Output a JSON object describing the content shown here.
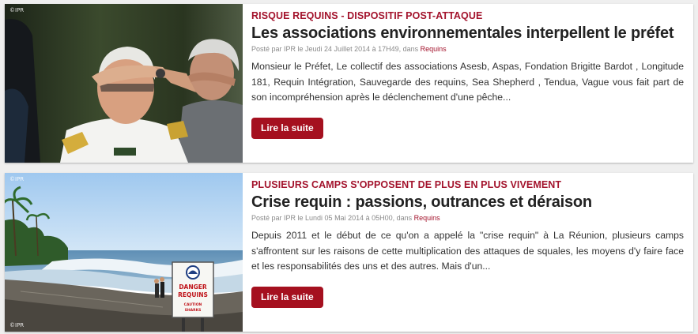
{
  "articles": [
    {
      "kicker": "RISQUE REQUINS - DISPOSITIF POST-ATTAQUE",
      "title": "Les associations environnementales interpellent le préfet",
      "meta_prefix": "Posté par IPR le Jeudi 24 Juillet 2014 à 17H49, dans",
      "category": "Requins",
      "excerpt": "Monsieur le Préfet, Le collectif des associations Asesb, Aspas, Fondation Brigitte Bardot , Longitude 181, Requin Intégration, Sauvegarde des requins, Sea Shepherd , Tendua, Vague vous fait part de son incompréhension après le déclenchement d'une pêche...",
      "button": "Lire la suite",
      "watermark": "©IPR"
    },
    {
      "kicker": "PLUSIEURS CAMPS S'OPPOSENT DE PLUS EN PLUS VIVEMENT",
      "title": "Crise requin : passions, outrances et déraison",
      "meta_prefix": "Posté par IPR le Lundi 05 Mai 2014 à 05H00, dans",
      "category": "Requins",
      "excerpt": "Depuis 2011 et le début de ce qu'on a appelé la \"crise requin\" à La Réunion, plusieurs camps s'affrontent sur les raisons de cette multiplication des attaques de squales, les moyens d'y faire face et les responsabilités des uns et des autres. Mais d'un...",
      "button": "Lire la suite",
      "watermark": "©IPR",
      "sign": {
        "line1": "DANGER",
        "line2": "REQUINS",
        "line3": "CAUTION",
        "line4": "SHARKS"
      }
    }
  ],
  "colors": {
    "accent": "#a3132c",
    "button": "#a5101f"
  }
}
